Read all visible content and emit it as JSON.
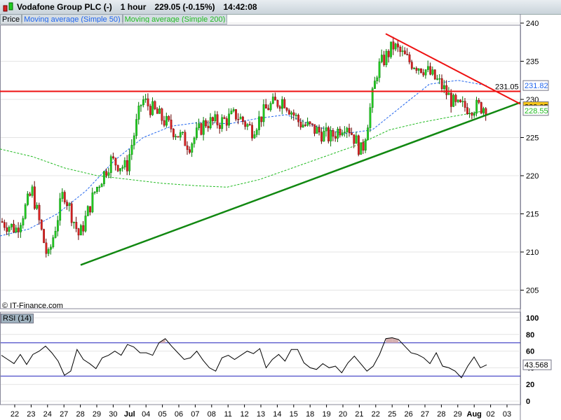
{
  "header": {
    "title": "Vodafone Group PLC (-)",
    "interval": "1 hour",
    "price": "229.05 (-0.15%)",
    "time": "14:42:08"
  },
  "legend": {
    "price": "Price",
    "ma50": "Moving average (Simple 50)",
    "ma200": "Moving average (Simple 200)"
  },
  "copyright": "© IT-Finance.com",
  "rsi_label": "RSI (14)",
  "colors": {
    "up": "#22cc22",
    "down": "#dd2222",
    "ma50": "#2266ee",
    "ma200": "#22bb22",
    "trend_up": "#118811",
    "resist": "#ee1111"
  },
  "chart_data": [
    {
      "type": "candlestick",
      "title": "Vodafone Group PLC",
      "ylim": [
        202,
        241
      ],
      "yticks": [
        "240",
        "235",
        "230",
        "225",
        "220",
        "215",
        "210",
        "205"
      ],
      "xticks": [
        "22",
        "23",
        "24",
        "27",
        "28",
        "29",
        "30",
        "Jul",
        "04",
        "05",
        "06",
        "07",
        "08",
        "11",
        "12",
        "13",
        "14",
        "15",
        "18",
        "19",
        "20",
        "21",
        "22",
        "25",
        "26",
        "27",
        "28",
        "29",
        "Aug",
        "02",
        "03"
      ],
      "closes_by_session": [
        214,
        213,
        218,
        209,
        218,
        212,
        218,
        222,
        221,
        230,
        228,
        226,
        224,
        227,
        227,
        228,
        226,
        229,
        230,
        227,
        226,
        225,
        227,
        223,
        234,
        237,
        235,
        234,
        232,
        229,
        229,
        229.05
      ],
      "ma50": [
        212.1,
        213,
        215,
        218,
        222,
        225,
        226.5,
        227,
        226.8,
        227.5,
        228,
        226.5,
        225.5,
        226,
        229,
        232,
        232.5,
        231.82
      ],
      "ma200": [
        223.5,
        222.5,
        221,
        220,
        219.5,
        219,
        218.7,
        218.5,
        219.5,
        221,
        222.5,
        224,
        226,
        227,
        227.8,
        228.55
      ],
      "horizontal_line": {
        "value": 231.05,
        "label": "231.05"
      },
      "support_line": {
        "from": 208.3,
        "to": 229.6
      },
      "resistance_line": {
        "from": 238.6,
        "to": 229.4
      },
      "labels": {
        "ma50": "231.82",
        "last": "229.05",
        "ma200": "228.55"
      }
    },
    {
      "type": "line",
      "title": "RSI (14)",
      "ylim": [
        0,
        100
      ],
      "yticks": [
        "100",
        "80",
        "60",
        "40",
        "20",
        "0"
      ],
      "levels": [
        70,
        30
      ],
      "values": [
        55,
        50,
        45,
        56,
        44,
        56,
        60,
        66,
        58,
        48,
        31,
        36,
        62,
        50,
        45,
        39,
        52,
        55,
        60,
        55,
        68,
        65,
        58,
        58,
        55,
        70,
        75,
        66,
        58,
        50,
        52,
        60,
        49,
        40,
        36,
        52,
        55,
        50,
        55,
        60,
        57,
        63,
        40,
        50,
        56,
        48,
        62,
        62,
        46,
        40,
        38,
        45,
        40,
        42,
        34,
        46,
        54,
        45,
        36,
        42,
        56,
        75,
        76,
        74,
        66,
        58,
        56,
        52,
        45,
        58,
        42,
        40,
        36,
        28,
        42,
        53,
        40,
        43.568
      ],
      "last_label": "43.568"
    }
  ]
}
